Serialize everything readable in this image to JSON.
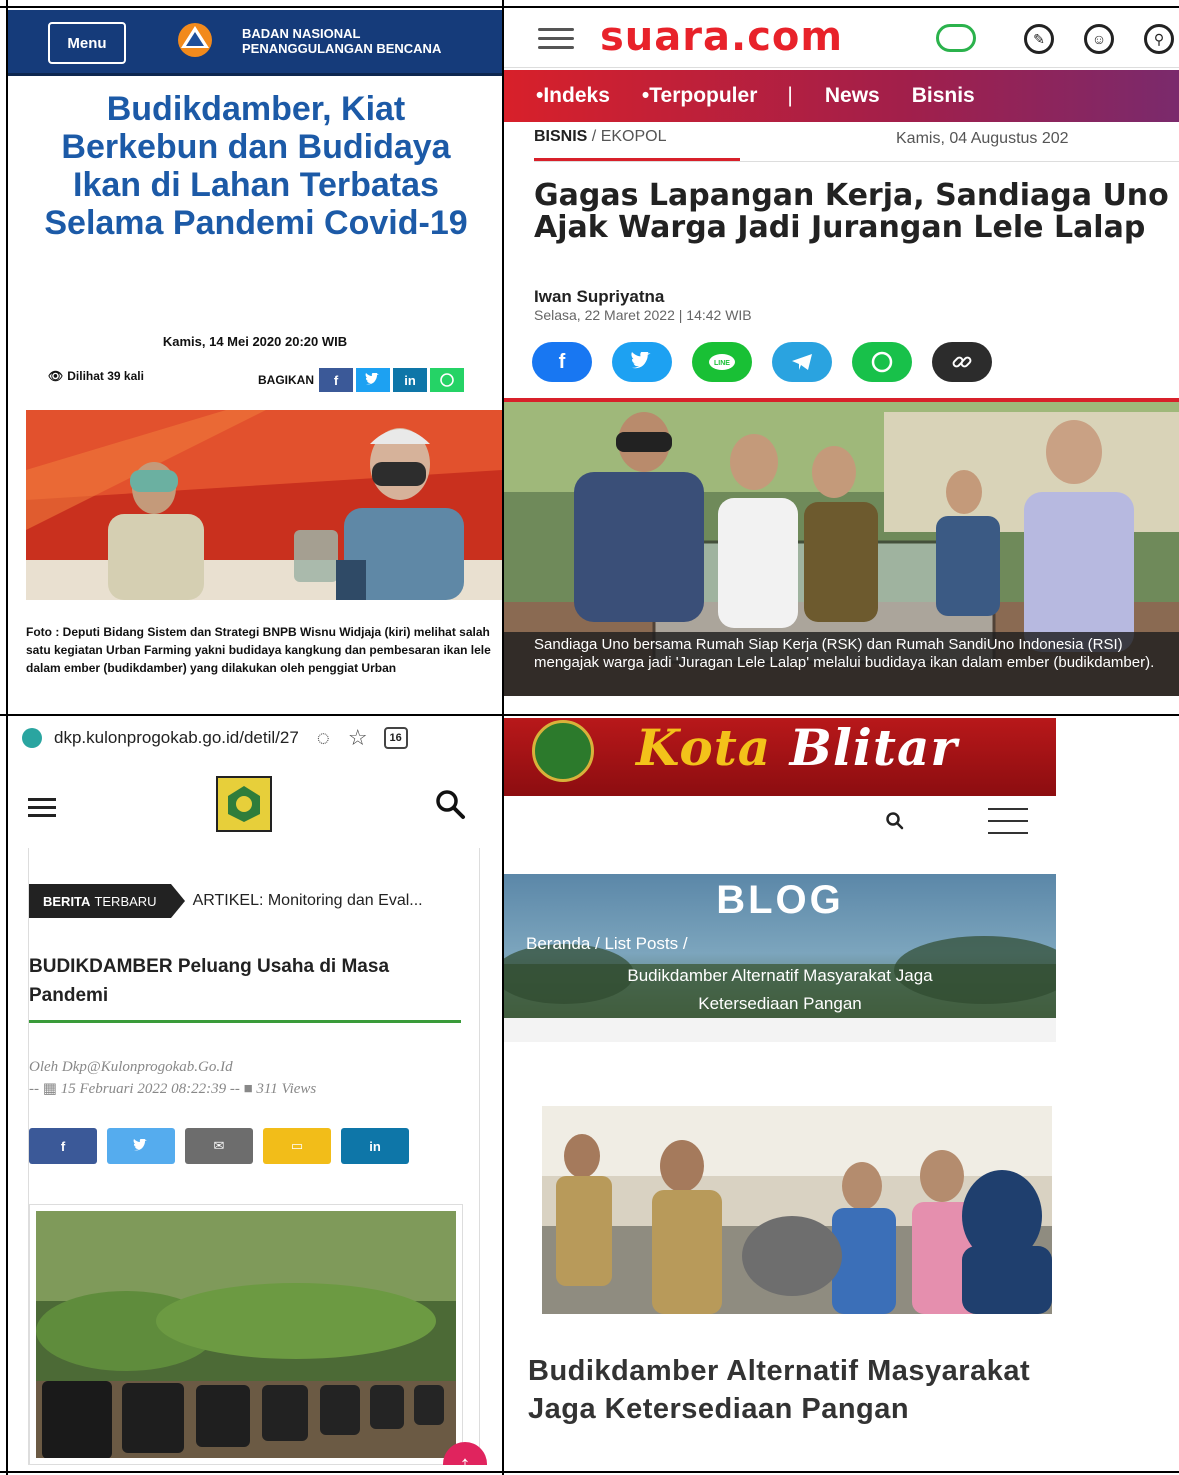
{
  "bnpb": {
    "menu_label": "Menu",
    "org_line1": "BADAN NASIONAL",
    "org_line2": "PENANGGULANGAN BENCANA",
    "logo_text": "BNPB",
    "title": "Budikdamber, Kiat Berkebun dan Budidaya Ikan di Lahan Terbatas Selama Pandemi Covid-19",
    "date": "Kamis, 14 Mei 2020 20:20 WIB",
    "views": "Dilihat 39 kali",
    "share_label": "BAGIKAN",
    "share_buttons": [
      "f",
      "t",
      "in",
      "w"
    ],
    "caption": "Foto : Deputi Bidang Sistem dan Strategi BNPB Wisnu Widjaja (kiri) melihat salah satu kegiatan Urban Farming yakni budidaya kangkung dan pembesaran ikan lele dalam ember (budikdamber) yang dilakukan oleh penggiat Urban",
    "colors": {
      "header": "#153b7a",
      "title": "#1c5aa7"
    }
  },
  "suara": {
    "logo": "suara.com",
    "nav": [
      "•Indeks",
      "•Terpopuler",
      "|",
      "News",
      "Bisnis"
    ],
    "crumb_section": "BISNIS",
    "crumb_sub": "EKOPOL",
    "date": "Kamis, 04 Augustus 202",
    "title": "Gagas Lapangan Kerja, Sandiaga Uno Ajak Warga Jadi Jurangan Lele Lalap",
    "author": "Iwan Supriyatna",
    "author_date": "Selasa, 22 Maret 2022 | 14:42 WIB",
    "share_icons": [
      "facebook-icon",
      "twitter-icon",
      "line-icon",
      "telegram-icon",
      "whatsapp-icon",
      "link-icon"
    ],
    "caption": "Sandiaga Uno bersama Rumah Siap Kerja (RSK) dan Rumah SandiUno Indonesia (RSI) mengajak warga jadi 'Juragan Lele Lalap' melalui budidaya ikan dalam ember (budikdamber).",
    "colors": {
      "logo": "#e8222a",
      "nav_start": "#d8202a",
      "nav_end": "#7a2a6c"
    }
  },
  "kulonprogo": {
    "url": "dkp.kulonprogokab.go.id/detil/27",
    "tab_count": "16",
    "ticker_badge_bold": "BERITA",
    "ticker_badge_rest": "TERBARU",
    "ticker_text": "ARTIKEL: Monitoring dan Eval...",
    "title": "BUDIKDAMBER Peluang Usaha di Masa Pandemi",
    "meta_author": "Oleh Dkp@Kulonprogokab.Go.Id",
    "meta_date": "15 Februari 2022 08:22:39",
    "meta_views": "311 Views",
    "share_buttons": [
      "f",
      "t",
      "✉",
      "▭",
      "in"
    ],
    "colors": {
      "green_rule": "#3a9b3a",
      "scroll_top": "#e0245e"
    }
  },
  "blitar": {
    "name_part1": "Kota",
    "name_part2": "Blitar",
    "hero_title": "BLOG",
    "crumb": "Beranda / List Posts /",
    "crumb_current": "Budikdamber Alternatif Masyarakat Jaga Ketersediaan Pangan",
    "title": "Budikdamber Alternatif Masyarakat Jaga Ketersediaan Pangan",
    "colors": {
      "banner": "#b8181a",
      "name": "#f3c21a"
    }
  }
}
